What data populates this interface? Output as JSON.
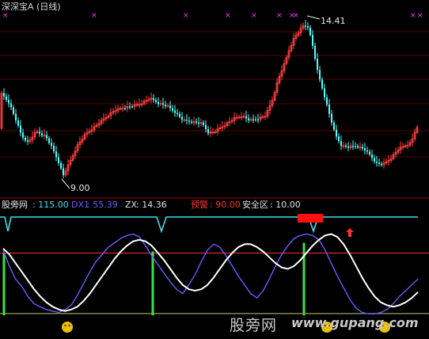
{
  "main_chart": {
    "title": "深深宝A (日线)",
    "high_label": "14.41",
    "low_label": "9.00",
    "candle_up_color": "#ff4040",
    "candle_down_color": "#54ffff"
  },
  "indicator": {
    "name": "股旁网",
    "name_value": ": 115.00",
    "dx1_label": "DX1",
    "dx1_value": ": 55.39",
    "zx_label": "ZX",
    "zx_value": ": 14.36",
    "warn_label": "预警",
    "warn_value": ": 90.00",
    "safe_label": "安全区",
    "safe_value": ": 10.00",
    "dx1_color": "#6a5cff",
    "zx_color": "#ffffff",
    "warn_color": "#ff3030",
    "top_line_color": "#40e0f0",
    "signal_bar_color": "#40e040"
  },
  "watermark": {
    "text": "股旁网",
    "url": "www.gupang.com"
  },
  "chart_data": {
    "type": "line",
    "series": [
      {
        "name": "DX1",
        "values": [
          92,
          70,
          52,
          42,
          28,
          18,
          14,
          10,
          8,
          6,
          10,
          16,
          30,
          46,
          62,
          76,
          86,
          96,
          102,
          108,
          112,
          114,
          110,
          98,
          84,
          72,
          60,
          48,
          38,
          32,
          44,
          58,
          76,
          92,
          100,
          96,
          84,
          70,
          56,
          44,
          32,
          26,
          36,
          52,
          70,
          86,
          98,
          108,
          112,
          114,
          112,
          106,
          92,
          74,
          56,
          40,
          24,
          12,
          6,
          4,
          4,
          6,
          10,
          18,
          28,
          36,
          44,
          52
        ]
      },
      {
        "name": "ZX",
        "values": [
          94,
          86,
          74,
          62,
          50,
          38,
          28,
          20,
          14,
          10,
          8,
          10,
          14,
          22,
          32,
          44,
          56,
          68,
          80,
          90,
          98,
          104,
          106,
          104,
          98,
          88,
          78,
          66,
          54,
          44,
          38,
          36,
          38,
          44,
          54,
          66,
          78,
          88,
          96,
          100,
          100,
          96,
          90,
          82,
          74,
          68,
          66,
          70,
          78,
          88,
          98,
          106,
          112,
          114,
          110,
          100,
          86,
          70,
          54,
          40,
          28,
          20,
          16,
          14,
          16,
          20,
          26,
          34
        ]
      }
    ],
    "levels": {
      "股旁网": 115.0,
      "预警": 90.0,
      "安全区": 10.0
    },
    "ylim": [
      0,
      120
    ]
  }
}
